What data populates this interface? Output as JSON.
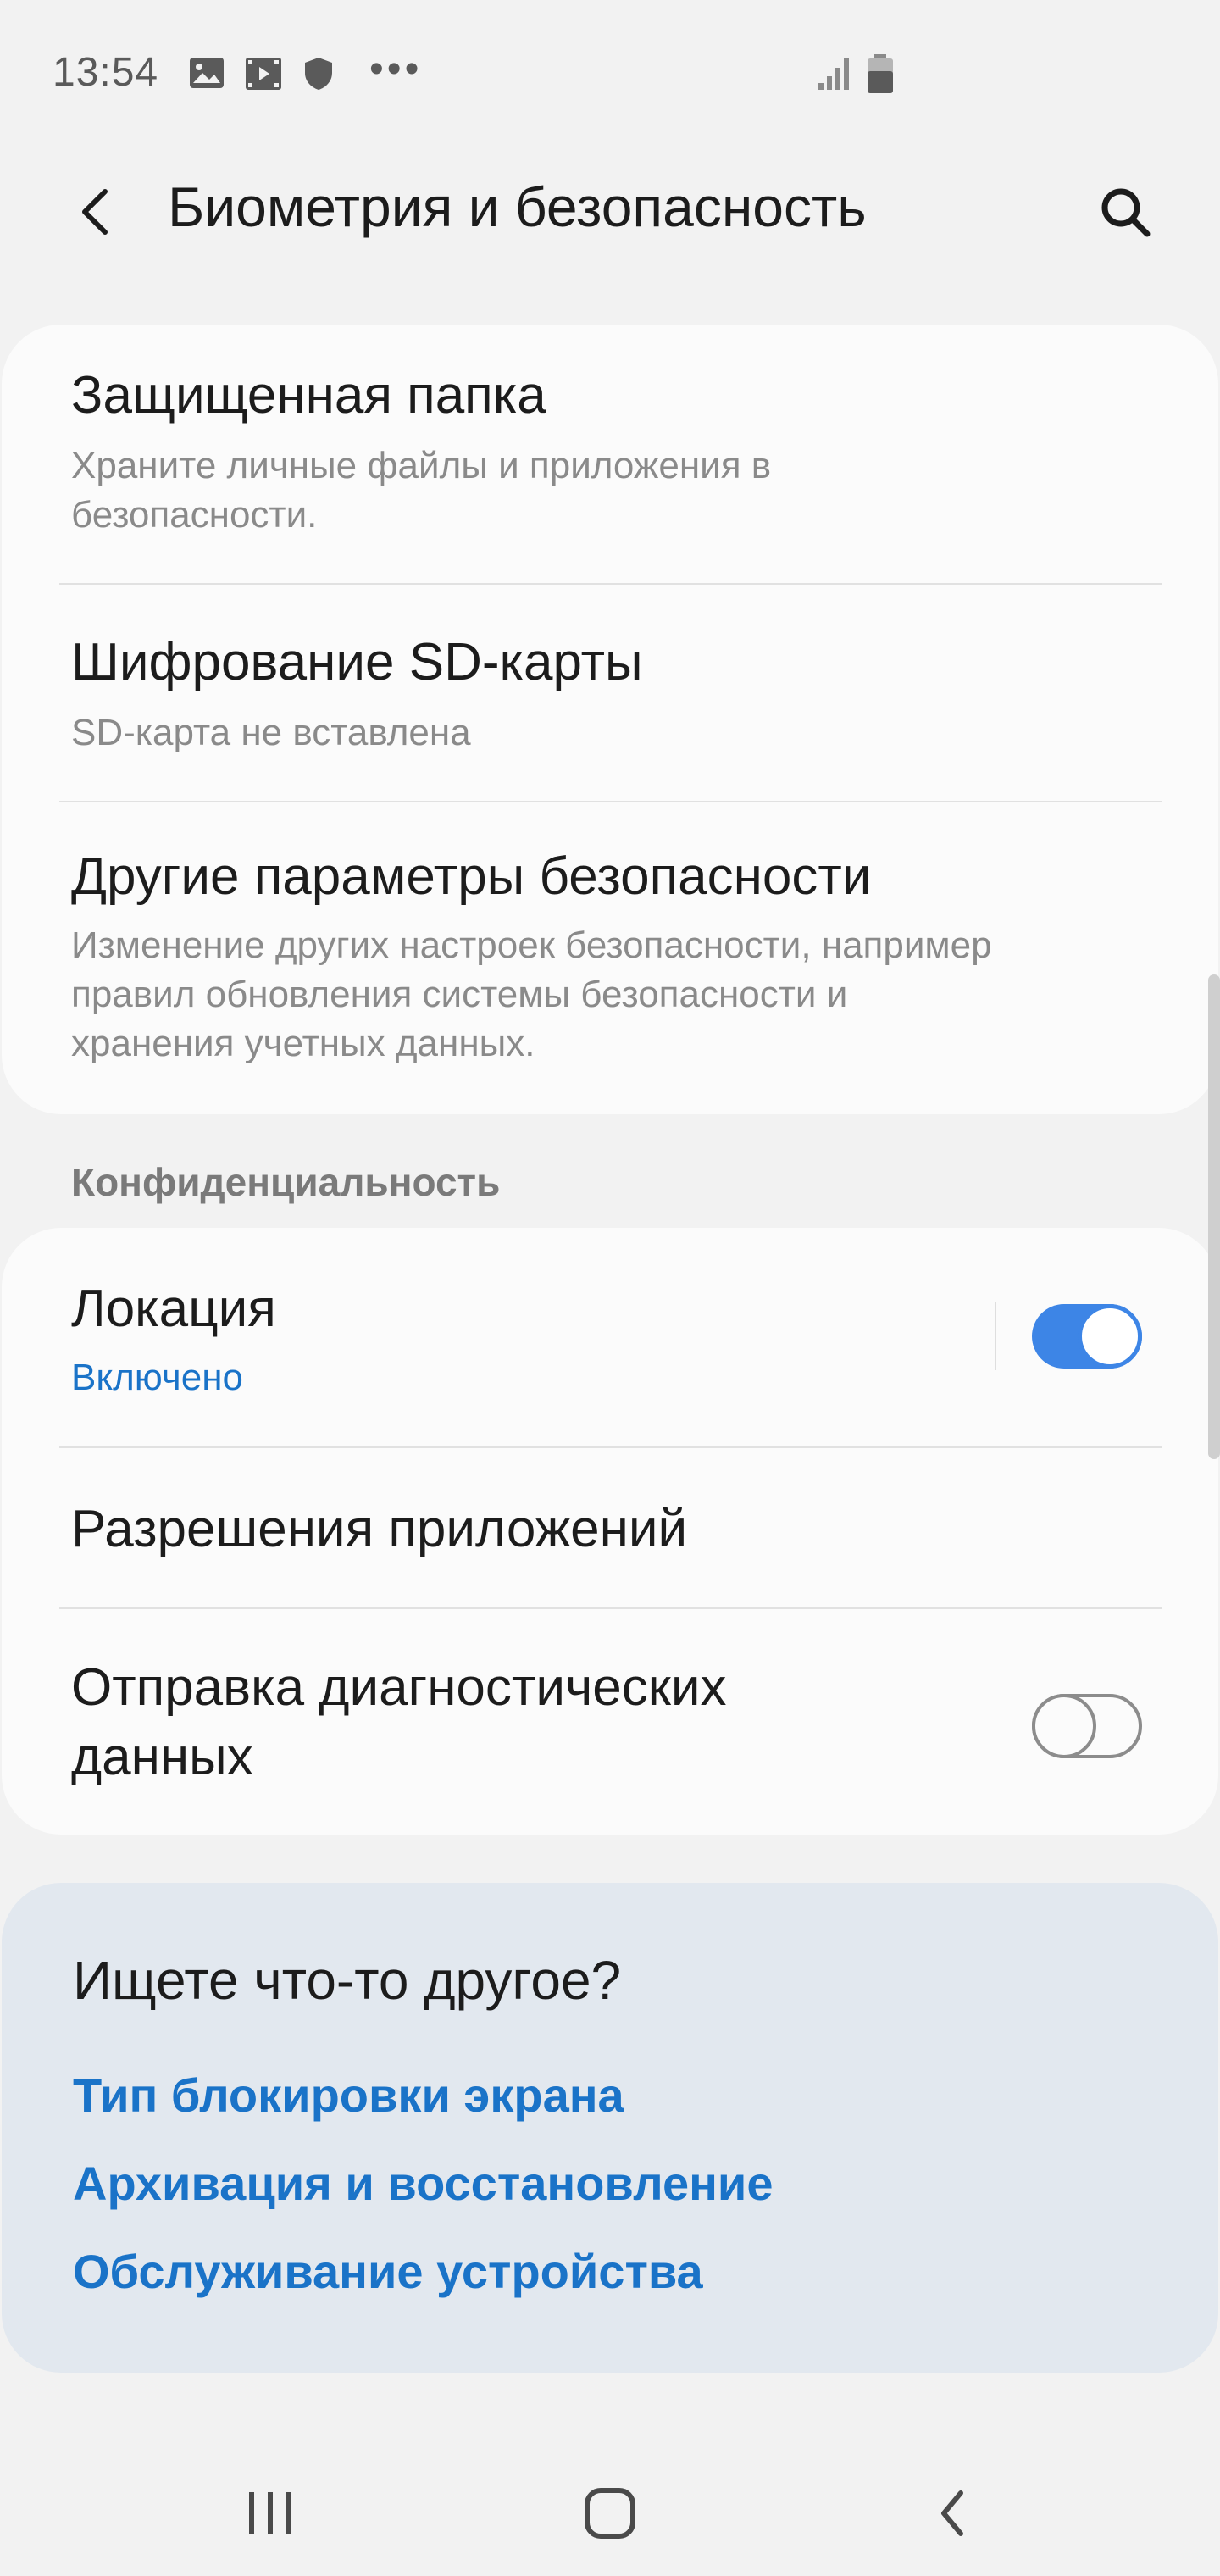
{
  "status_bar": {
    "time": "13:54",
    "icons": [
      "gallery-icon",
      "video-icon",
      "shield-icon",
      "more-icon",
      "signal-icon",
      "battery-icon"
    ],
    "dots": "•••"
  },
  "header": {
    "title": "Биометрия и безопасность",
    "back_icon": "chevron-left-icon",
    "search_icon": "search-icon"
  },
  "security_items": [
    {
      "title": "Защищенная папка",
      "subtitle": "Храните личные файлы и приложения в безопасности."
    },
    {
      "title": "Шифрование SD-карты",
      "subtitle": "SD-карта не вставлена"
    },
    {
      "title": "Другие параметры безопасности",
      "subtitle": "Изменение других настроек безопасности, например правил обновления системы безопасности и хранения учетных данных."
    }
  ],
  "privacy": {
    "section_title": "Конфиденциальность",
    "location": {
      "title": "Локация",
      "status": "Включено",
      "enabled": true
    },
    "app_permissions": {
      "title": "Разрешения приложений"
    },
    "diagnostics": {
      "title": "Отправка диагностических данных",
      "enabled": false
    }
  },
  "looking_for": {
    "title": "Ищете что-то другое?",
    "links": [
      "Тип блокировки экрана",
      "Архивация и восстановление",
      "Обслуживание устройства"
    ]
  },
  "colors": {
    "accent": "#1a73c8",
    "toggle_on": "#3d85e6",
    "background": "#f2f2f2",
    "card": "#fbfbfb",
    "suggestion_card": "#e2e8ef"
  },
  "nav_bar": {
    "icons": [
      "recents-icon",
      "home-icon",
      "back-icon"
    ]
  }
}
